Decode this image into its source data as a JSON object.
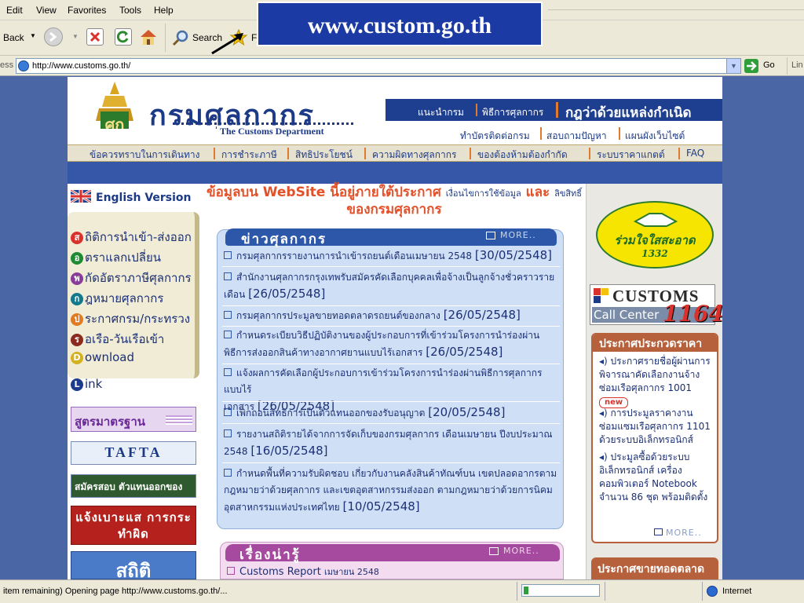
{
  "browser": {
    "menu": [
      "Edit",
      "View",
      "Favorites",
      "Tools",
      "Help"
    ],
    "toolbar": {
      "back_label": "Back",
      "search_label": "Search",
      "fav_label": "F"
    },
    "address": {
      "label": "ess",
      "url": "http://www.customs.go.th/",
      "go_label": "Go",
      "links_label": "Lin"
    },
    "status": {
      "text": "item remaining) Opening page http://www.customs.go.th/...",
      "zone": "Internet"
    }
  },
  "overlay_banner": "www.custom.go.th",
  "header": {
    "logo_thai": "กรมศุลกากร",
    "logo_en": "The Customs Department",
    "top_links": [
      "แนะนำกรม",
      "พิธีการศุลกากร"
    ],
    "rules_link": "กฎว่าด้วยแหล่งกำเนิด",
    "sub_links": [
      "ทำบัตรติดต่อกรม",
      "สอบถามปัญหา",
      "แผนผังเว็บไซต์"
    ]
  },
  "nav": [
    "ข้อควรทราบในการเดินทาง",
    "การชำระภาษี",
    "สิทธิประโยชน์",
    "ความผิดทางศุลกากร",
    "ของต้องห้ามต้องกำกัด",
    "ระบบราคาแกตต์",
    "FAQ"
  ],
  "left": {
    "english": "English Version",
    "menu": [
      {
        "badge": "ส",
        "color": "#d9322c",
        "label": "ถิติการนำเข้า-ส่งออก"
      },
      {
        "badge": "อ",
        "color": "#1f8a34",
        "label": "ตราแลกเปลี่ยน"
      },
      {
        "badge": "พ",
        "color": "#8a3c9a",
        "label": "กัดอัตราภาษีศุลกากร"
      },
      {
        "badge": "ก",
        "color": "#137a8c",
        "label": "ฎหมายศุลกากร"
      },
      {
        "badge": "ป",
        "color": "#e07b22",
        "label": "ระกาศกรม/กระทรวง"
      },
      {
        "badge": "ร",
        "color": "#8b2a1f",
        "label": "อเรือ-วันเรือเข้า"
      },
      {
        "badge": "D",
        "color": "#d4b21f",
        "label": "ownload"
      },
      {
        "badge": "L",
        "color": "#1c3b8c",
        "label": "ink"
      }
    ],
    "banners": [
      "สูตรมาตรฐาน",
      "TAFTA",
      "สมัครสอบ ตัวแทนออกของ",
      "แจ้งเบาะแส การกระทำผิด",
      "สถิติ"
    ]
  },
  "center": {
    "notice_1": "ข้อมูลบน WebSite นี้อยู่ภายใต้ประกาศ",
    "notice_small_1": "เงื่อนไขการใช้ข้อมูล",
    "notice_and": "และ",
    "notice_small_2": "ลิขสิทธิ์",
    "notice_2": "ของกรมศุลกากร",
    "news_title": "ข่าวศุลกากร",
    "more": "MORE..",
    "news": [
      {
        "text": "กรมศุลกากรรายงานการนำเข้ารถยนต์เดือนเมษายน 2548",
        "date": "[30/05/2548]"
      },
      {
        "text": "สำนักงานศุลกากรกรุงเทพรับสมัครคัดเลือกบุคคลเพื่อจ้างเป็นลูกจ้างชั่วคราวราย",
        "text2": "เดือน",
        "date": "[26/05/2548]"
      },
      {
        "text": "กรมศุลกากรประมูลขายทอดตลาดรถยนต์ของกลาง",
        "date": "[26/05/2548]"
      },
      {
        "text": "กำหนดระเบียบวิธีปฏิบัติงานของผู้ประกอบการที่เข้าร่วมโครงการนำร่องผ่าน",
        "text2": "พิธีการส่งออกสินค้าทางอากาศยานแบบไร้เอกสาร",
        "date": "[26/05/2548]"
      },
      {
        "text": "แจ้งผลการคัดเลือกผู้ประกอบการเข้าร่วมโครงการนำร่องผ่านพิธีการศุลกากรแบบไร้",
        "text2": "เอกสาร",
        "date": "[26/05/2548]"
      },
      {
        "text": "เพิกถอนสิทธิการเป็นตัวแทนออกของรับอนุญาต",
        "date": "[20/05/2548]"
      },
      {
        "text": "รายงานสถิติรายได้จากการจัดเก็บของกรมศุลกากร เดือนเมษายน ปีงบประมาณ",
        "text2": "2548",
        "date": "[16/05/2548]"
      },
      {
        "text": "กำหนดพื้นที่ความรับผิดชอบ เกี่ยวกับงานคลังสินค้าทัณฑ์บน เขตปลอดอากรตาม",
        "text2": "กฎหมายว่าด้วยศุลกากร และเขตอุตสาหกรรมส่งออก ตามกฎหมายว่าด้วยการนิคม",
        "text3": "อุตสาหกรรมแห่งประเทศไทย",
        "date": "[10/05/2548]"
      }
    ],
    "story_title": "เรื่องน่ารู้",
    "story_item": "Customs Report",
    "story_item_small": "เมษายน 2548"
  },
  "right": {
    "badge_text": "ร่วมใจใสสะอาด",
    "badge_num": "1332",
    "callcenter_top": "CUSTOMS",
    "callcenter_bottom": "Call Center",
    "callcenter_num": "1164",
    "tender_title": "ประกาศประกวดราคา",
    "tender_items": [
      "ประกาศรายชื่อผู้ผ่านการพิจารณาคัดเลือกงานจ้างซ่อมเรือศุลกากร 1001",
      "การประมูลราคางานซ่อมแซมเรือศุลกากร 1101 ด้วยระบบอิเล็กทรอนิกส์",
      "ประมูลซื้อด้วยระบบอิเล็กทรอนิกส์ เครื่องคอมพิวเตอร์ Notebook จำนวน 86 ชุด พร้อมติดตั้ง"
    ],
    "new_badge": "new",
    "more": "MORE..",
    "auction_title": "ประกาศขายทอดตลาด"
  },
  "colors": {
    "ie_bg": "#ece9d8",
    "page_bg": "#4a66a5",
    "accent_blue": "#1e3f8f",
    "red": "#d9322c"
  }
}
